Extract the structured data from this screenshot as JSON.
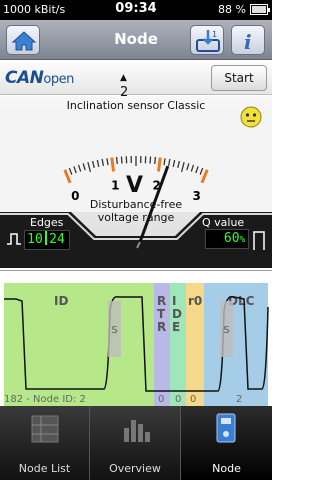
{
  "status": {
    "bitrate": "1000 kBit/s",
    "time": "09:34",
    "battery": "88 %"
  },
  "titlebar": {
    "title": "Node"
  },
  "canopen": {
    "logo_main": "CAN",
    "logo_sub": "open",
    "node_selected": "2",
    "start_label": "Start"
  },
  "gauge": {
    "sensor_name": "Inclination sensor Classic",
    "tick_labels": [
      "0",
      "1",
      "2",
      "3"
    ],
    "unit": "V",
    "range_caption_1": "Disturbance-free",
    "range_caption_2": "voltage range",
    "needle_value": 2.1,
    "min": 0,
    "max": 3
  },
  "edges": {
    "label": "Edges",
    "value_a": "10",
    "value_b": "24"
  },
  "quality": {
    "label": "Q value",
    "value": "60",
    "unit": "%"
  },
  "signal": {
    "fields": [
      {
        "name": "ID",
        "color": "#b6e88a",
        "value": "182 - Node ID: 2"
      },
      {
        "name": "R T R",
        "color": "#b9b9e8",
        "value": "0"
      },
      {
        "name": "ID E",
        "color": "#9fe6bb",
        "value": "0"
      },
      {
        "name": "r0",
        "color": "#f5d98a",
        "value": "0"
      },
      {
        "name": "DLC",
        "color": "#a6cde8",
        "value": "2"
      }
    ],
    "stuff_bit_label": "S"
  },
  "tabs": [
    {
      "label": "Node List",
      "icon": "node-list-icon"
    },
    {
      "label": "Overview",
      "icon": "overview-icon"
    },
    {
      "label": "Node",
      "icon": "node-icon"
    }
  ],
  "colors": {
    "accent_orange": "#e87a1f",
    "lcd_green": "#2fff2f"
  }
}
